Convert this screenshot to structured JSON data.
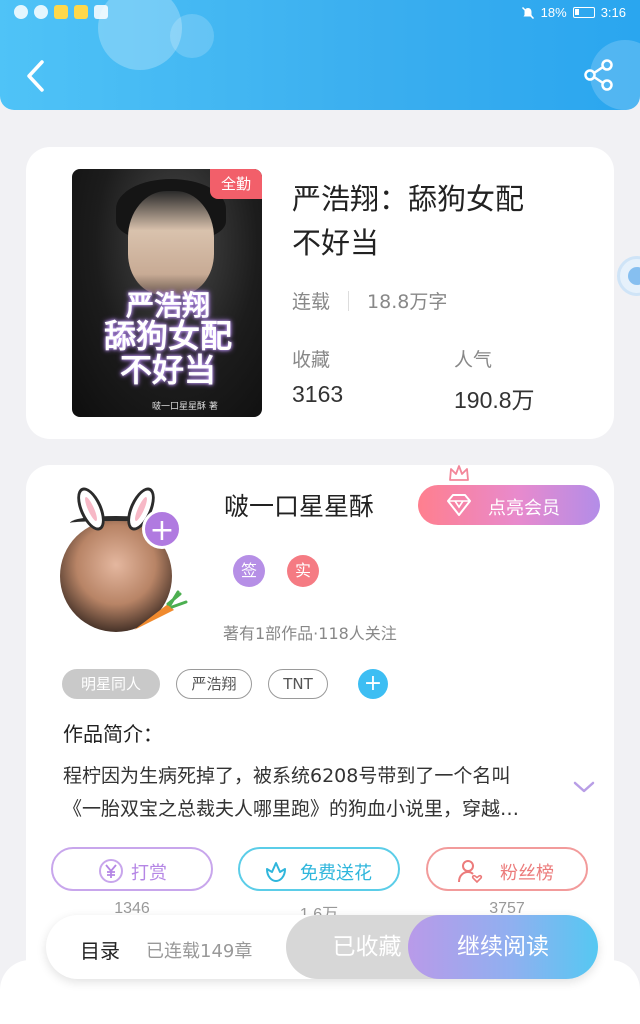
{
  "status_bar": {
    "battery": "18%",
    "time": "3:16"
  },
  "header": {
    "back_icon": "chevron-left-icon",
    "share_icon": "share-icon"
  },
  "book": {
    "badge": "全勤",
    "title_line1": "严浩翔：舔狗女配",
    "title_line2": "不好当",
    "status": "连载",
    "word_count": "18.8万字",
    "favorites_label": "收藏",
    "favorites_value": "3163",
    "popularity_label": "人气",
    "popularity_value": "190.8万",
    "cover": {
      "title_line1": "严浩翔",
      "title_line2": "舔狗女配",
      "title_line3": "不好当",
      "author": "啵一口星星酥 著"
    }
  },
  "author": {
    "name": "啵一口星星酥",
    "vip_button": "点亮会员",
    "badge_sign": "签",
    "badge_real": "实",
    "stats": "著有1部作品·118人关注"
  },
  "tags": [
    "明星同人",
    "严浩翔",
    "TNT"
  ],
  "intro": {
    "label": "作品简介：",
    "line1": "程柠因为生病死掉了，被系统6208号带到了一个名叫",
    "line2": "《一胎双宝之总裁夫人哪里跑》的狗血小说里，穿越…"
  },
  "actions": [
    {
      "label": "打赏",
      "count": "1346",
      "icon": "yen-coin-icon"
    },
    {
      "label": "免费送花",
      "count": "1.6万",
      "icon": "flower-icon"
    },
    {
      "label": "粉丝榜",
      "count": "3757",
      "icon": "fan-user-icon"
    }
  ],
  "bottom_bar": {
    "catalog": "目录",
    "chapters": "已连载149章",
    "collected": "已收藏",
    "continue_read": "继续阅读"
  },
  "colors": {
    "header_blue": "#3aaeef",
    "badge_red": "#f25f6a",
    "purple": "#b07ae0",
    "cyan": "#3dbef3"
  }
}
